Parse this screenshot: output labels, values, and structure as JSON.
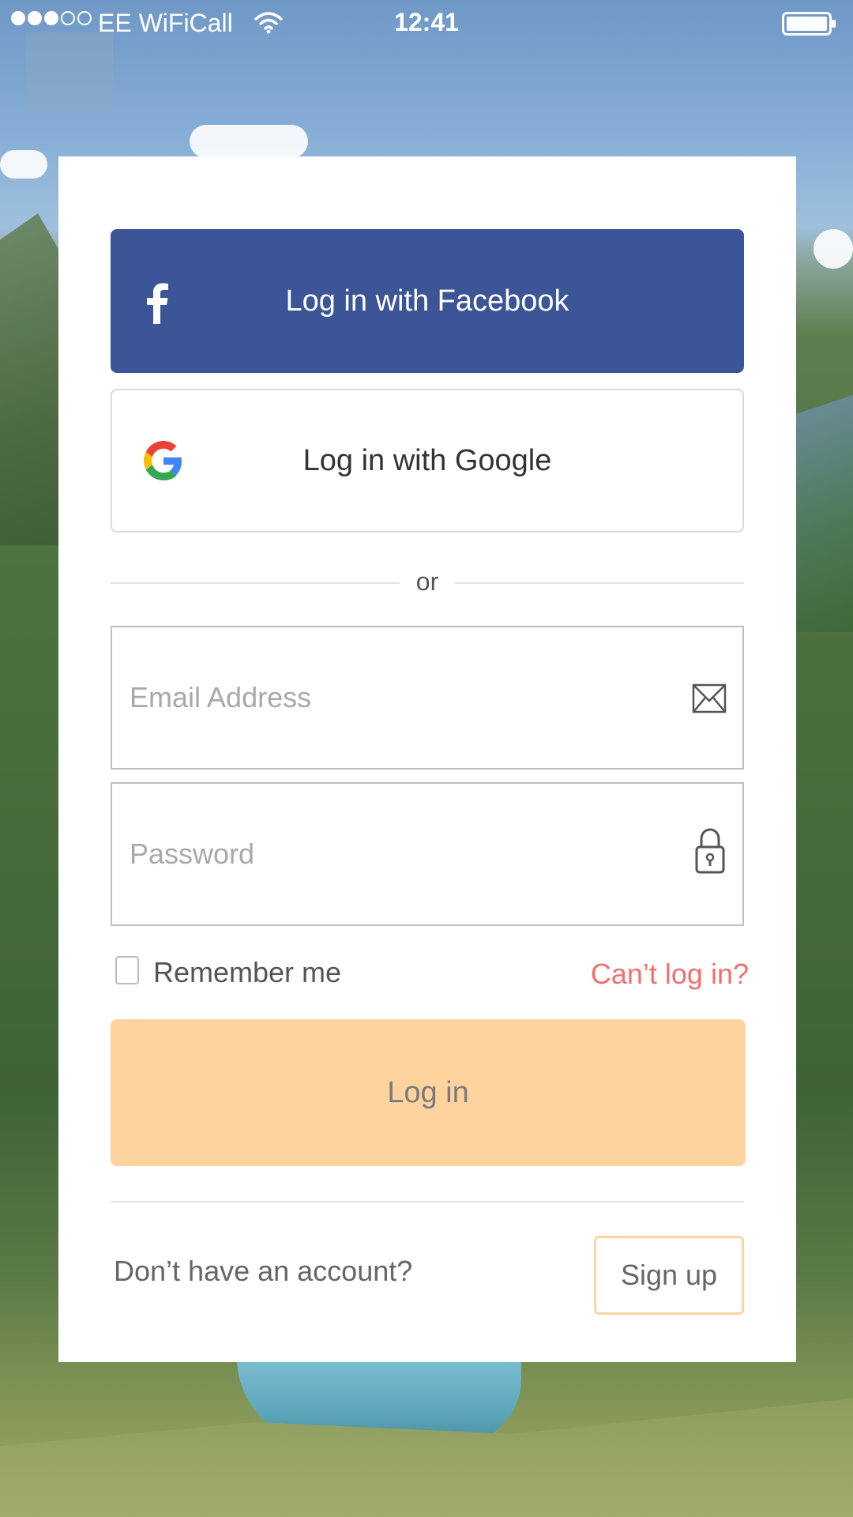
{
  "status_bar": {
    "carrier": "EE WiFiCall",
    "time": "12:41",
    "signal_bars_filled": 3,
    "signal_bars_total": 5
  },
  "login": {
    "facebook_button": "Log in with Facebook",
    "google_button": "Log in with Google",
    "divider_text": "or",
    "email_placeholder": "Email Address",
    "password_placeholder": "Password",
    "remember_label": "Remember me",
    "remember_checked": false,
    "cant_login_link": "Can’t log in?",
    "login_button": "Log in",
    "no_account_text": "Don’t have an account?",
    "signup_button": "Sign up"
  },
  "icons": {
    "facebook": "facebook-icon",
    "google": "google-icon",
    "email": "mail-icon",
    "password": "lock-icon",
    "wifi": "wifi-icon",
    "battery": "battery-icon"
  },
  "colors": {
    "facebook_blue": "#3b5597",
    "login_button": "#ffd39e",
    "signup_border": "#ffd39e",
    "cant_login_link": "#f06e6e"
  }
}
